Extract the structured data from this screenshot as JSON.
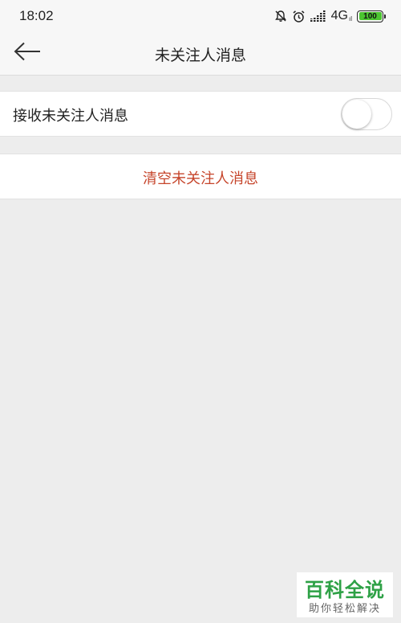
{
  "status_bar": {
    "time": "18:02",
    "network": "4G",
    "network_sub": "ıl",
    "battery": "100",
    "icons": [
      "bell-off-icon",
      "alarm-icon",
      "signal-icon",
      "battery-icon"
    ]
  },
  "nav": {
    "back_icon": "arrow-left-icon",
    "title": "未关注人消息"
  },
  "settings": {
    "receive_label": "接收未关注人消息",
    "receive_enabled": false,
    "clear_label": "清空未关注人消息"
  },
  "watermark": {
    "title": "百科全说",
    "subtitle": "助你轻松解决"
  },
  "colors": {
    "background": "#ededed",
    "clear_text": "#c6452b",
    "watermark_green": "#2ea146",
    "battery_green": "#4cc531"
  }
}
